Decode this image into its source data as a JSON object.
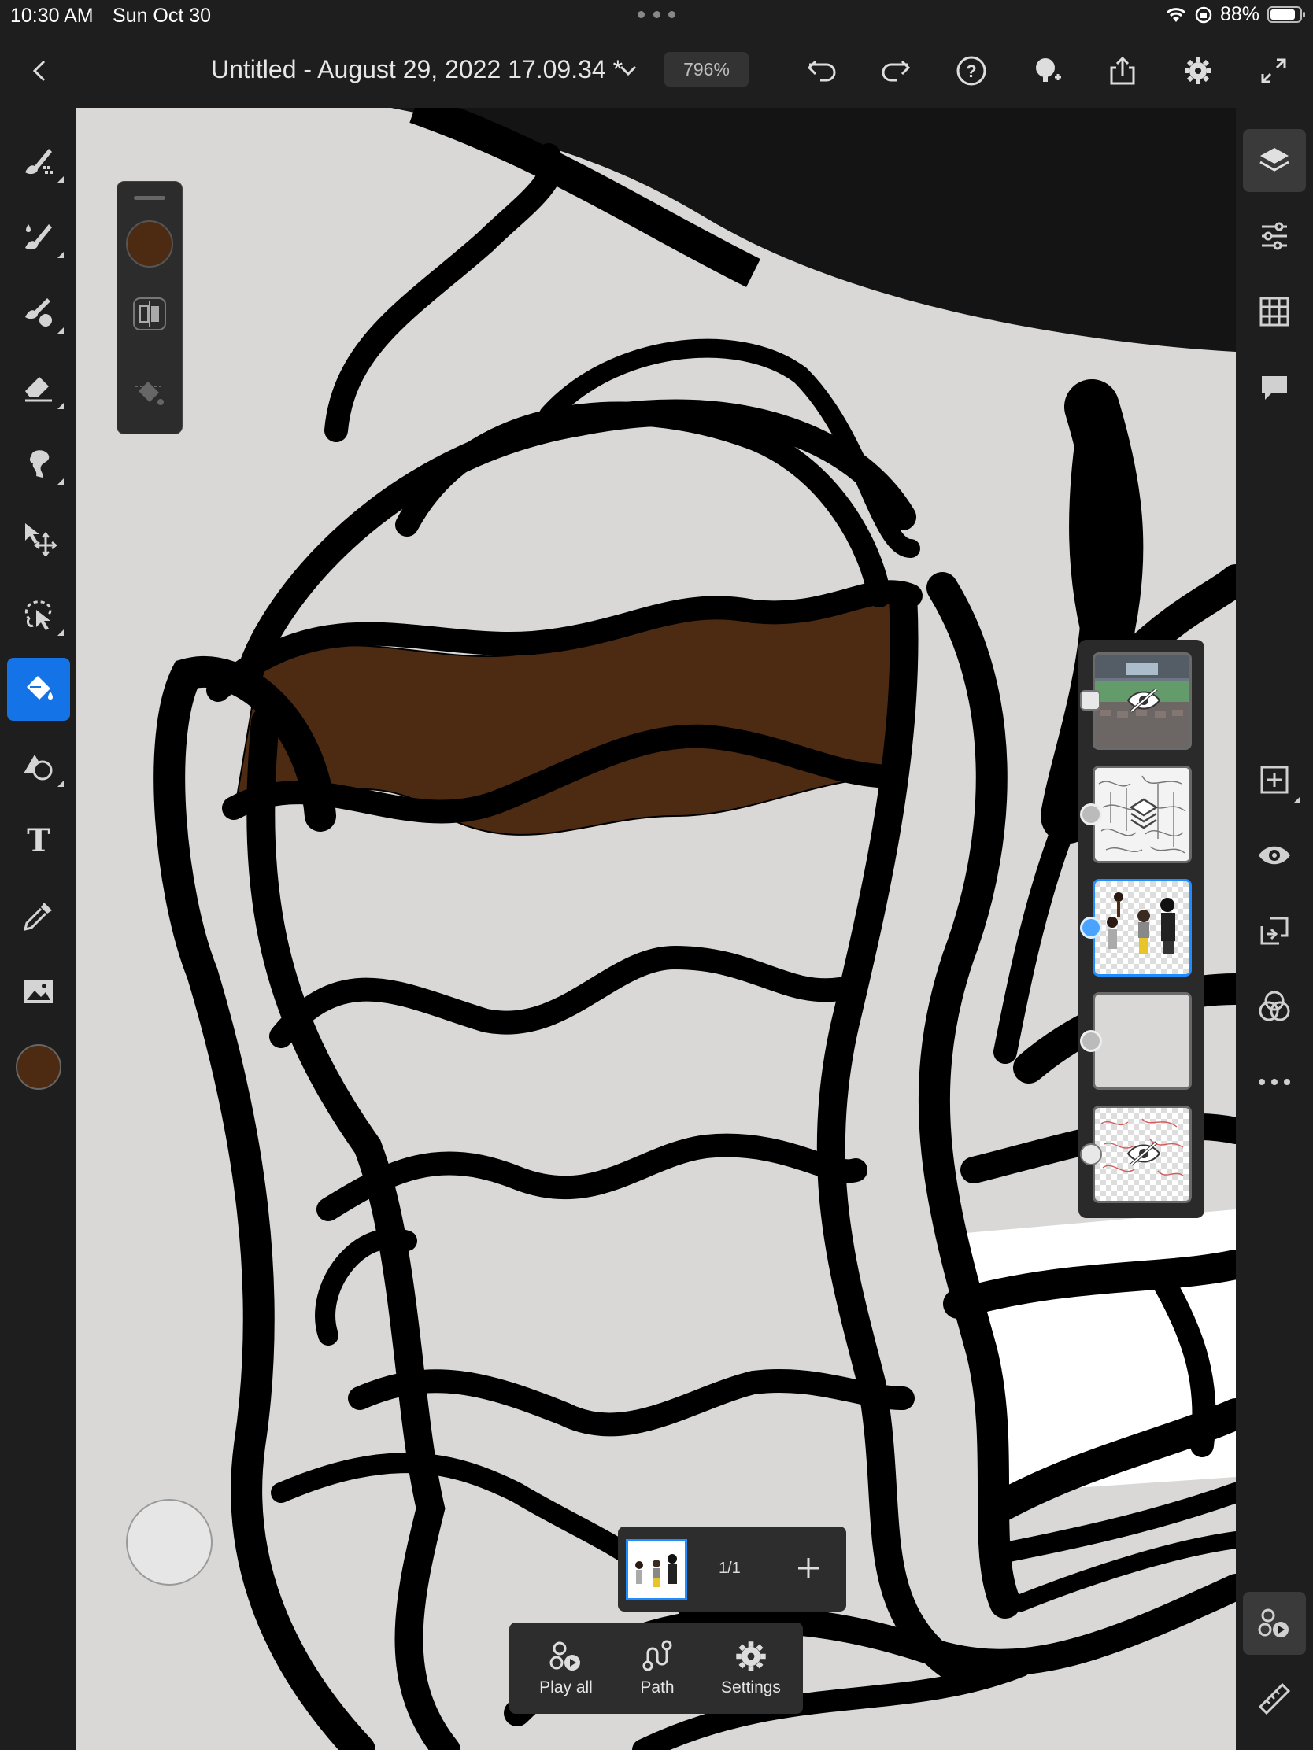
{
  "status_bar": {
    "time": "10:30 AM",
    "date": "Sun Oct 30",
    "battery": "88%"
  },
  "title_bar": {
    "title": "Untitled - August 29, 2022 17.09.34 *",
    "zoom": "796%"
  },
  "colors": {
    "accent": "#1473e6",
    "current_color": "#4d2a12",
    "canvas_bg": "#d9d8d7"
  },
  "left_tools": [
    "pixel-brush-icon",
    "live-brush-icon",
    "mixer-brush-icon",
    "eraser-icon",
    "smudge-icon",
    "move-icon",
    "lasso-select-icon",
    "fill-bucket-icon",
    "shapes-icon",
    "text-icon",
    "eyedropper-icon",
    "image-icon",
    "color-swatch"
  ],
  "right_tools": [
    "layers-icon",
    "layer-properties-icon",
    "grid-icon",
    "comments-icon",
    "add-layer-icon",
    "visibility-icon",
    "merge-down-icon",
    "blend-modes-icon",
    "more-icon",
    "playback-icon",
    "ruler-icon"
  ],
  "layers": [
    {
      "name": "Stadium image layer",
      "hidden": true
    },
    {
      "name": "Sketch group",
      "hidden": false
    },
    {
      "name": "Characters layer",
      "hidden": false,
      "selected": true
    },
    {
      "name": "Empty layer",
      "hidden": false
    },
    {
      "name": "Red sketch layer",
      "hidden": true
    }
  ],
  "timeline": {
    "frame_count": "1/1"
  },
  "playback": {
    "play_all": "Play all",
    "path": "Path",
    "settings": "Settings"
  }
}
